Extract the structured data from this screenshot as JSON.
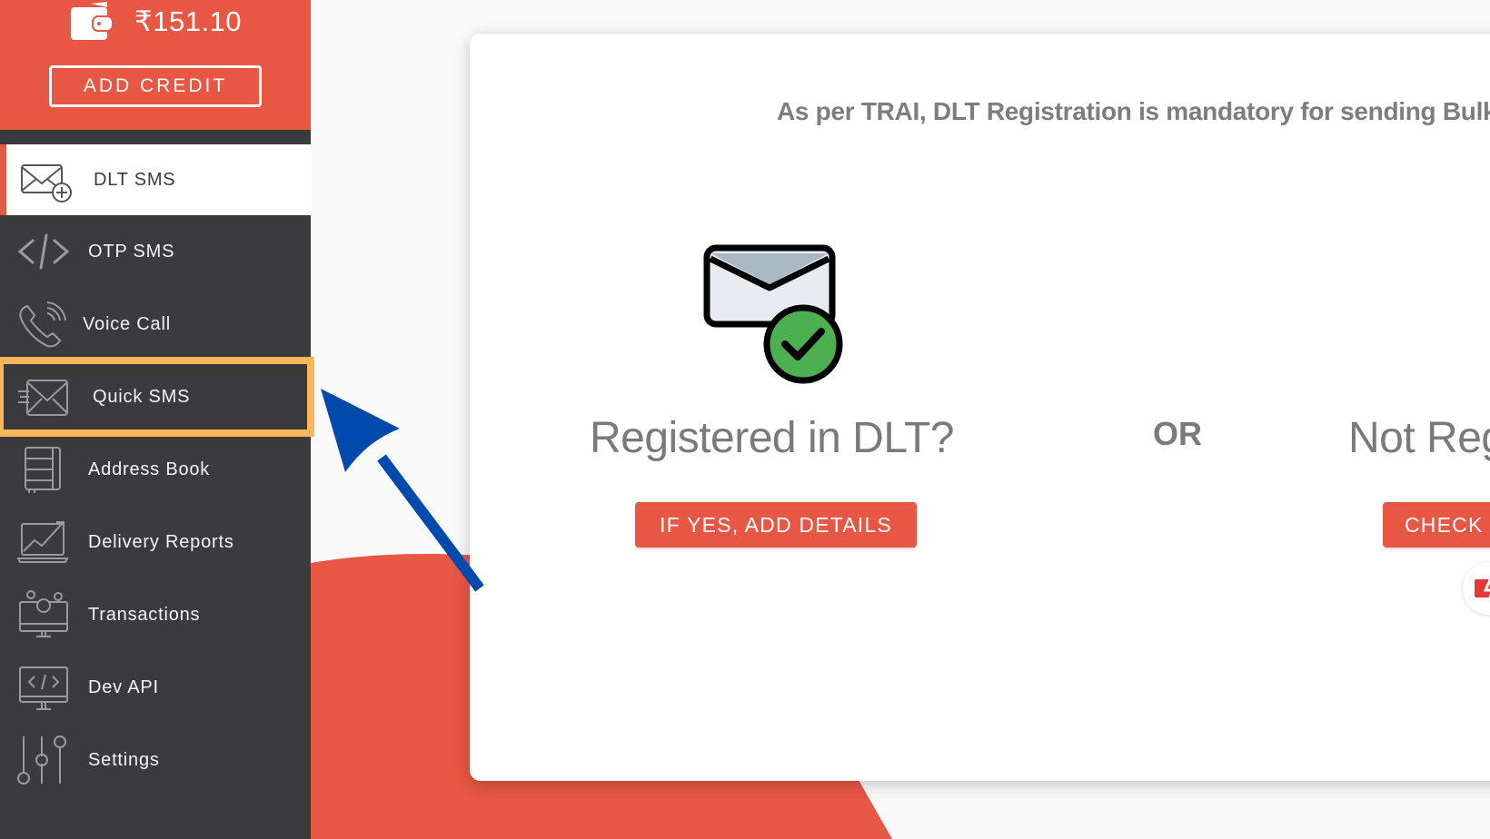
{
  "wallet": {
    "balance": "₹151.10",
    "add_credit_label": "ADD CREDIT",
    "icon": "wallet-icon"
  },
  "sidebar": {
    "items": [
      {
        "label": "DLT SMS",
        "icon": "mail-plus-icon",
        "active": true
      },
      {
        "label": "OTP SMS",
        "icon": "code-icon"
      },
      {
        "label": "Voice Call",
        "icon": "phone-call-icon"
      },
      {
        "label": "Quick SMS",
        "icon": "fast-mail-icon",
        "highlighted": true
      },
      {
        "label": "Address Book",
        "icon": "address-book-icon"
      },
      {
        "label": "Delivery Reports",
        "icon": "chart-laptop-icon"
      },
      {
        "label": "Transactions",
        "icon": "monitor-coins-icon"
      },
      {
        "label": "Dev API",
        "icon": "monitor-code-icon"
      },
      {
        "label": "Settings",
        "icon": "sliders-icon"
      }
    ]
  },
  "main": {
    "notice": "As per TRAI, DLT Registration is mandatory for sending Bulk",
    "registered": {
      "title": "Registered in DLT?",
      "button": "IF YES, ADD DETAILS",
      "icon": "mail-check-icon"
    },
    "or_label": "OR",
    "not_registered": {
      "title": "Not Registered",
      "button": "CHECK"
    }
  },
  "annotation": {
    "highlight_color": "#fdb75a",
    "arrow_color": "#004aad",
    "target": "Quick SMS"
  },
  "colors": {
    "brand_red": "#e85644",
    "sidebar_bg": "#3b3b3d",
    "text_gray": "#7a7a7a"
  }
}
